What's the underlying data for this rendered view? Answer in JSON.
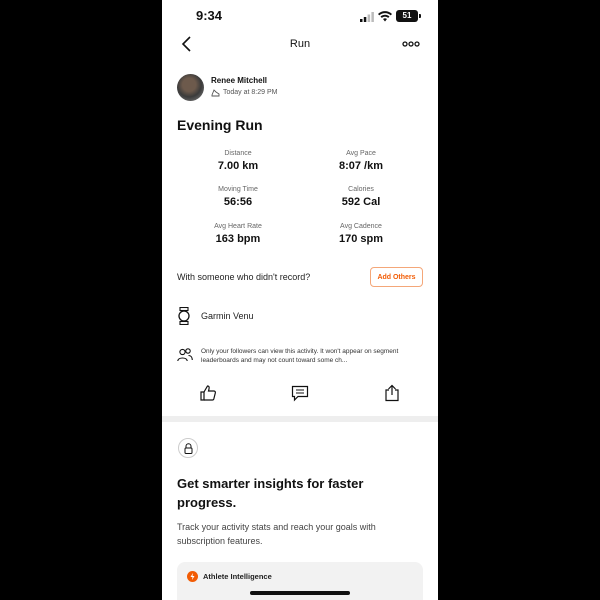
{
  "status_bar": {
    "time": "9:34",
    "battery": "51"
  },
  "nav": {
    "title": "Run",
    "back_icon": "chevron-left-icon",
    "more_icon": "more-horizontal-icon"
  },
  "athlete": {
    "name": "Renee Mitchell",
    "meta": "Today at 8:29 PM"
  },
  "activity": {
    "title": "Evening Run"
  },
  "stats": [
    {
      "label": "Distance",
      "value": "7.00 km"
    },
    {
      "label": "Avg Pace",
      "value": "8:07 /km"
    },
    {
      "label": "Moving Time",
      "value": "56:56"
    },
    {
      "label": "Calories",
      "value": "592 Cal"
    },
    {
      "label": "Avg Heart Rate",
      "value": "163 bpm"
    },
    {
      "label": "Avg Cadence",
      "value": "170 spm"
    }
  ],
  "with_someone": {
    "text": "With someone who didn't record?",
    "button": "Add Others"
  },
  "device": {
    "name": "Garmin Venu",
    "icon": "watch-icon"
  },
  "privacy": {
    "text": "Only your followers can view this activity. It won't appear on segment leaderboards and may not count toward some ch...",
    "icon": "followers-icon"
  },
  "actions": {
    "kudos_icon": "thumbs-up-icon",
    "comment_icon": "comment-icon",
    "share_icon": "share-icon"
  },
  "promo": {
    "title": "Get smarter insights for faster progress.",
    "body": "Track your activity stats and reach your goals with subscription features.",
    "card_label": "Athlete Intelligence"
  },
  "colors": {
    "accent": "#f25c05",
    "divider": "#eeeeee",
    "card_bg": "#f2f2f2"
  }
}
